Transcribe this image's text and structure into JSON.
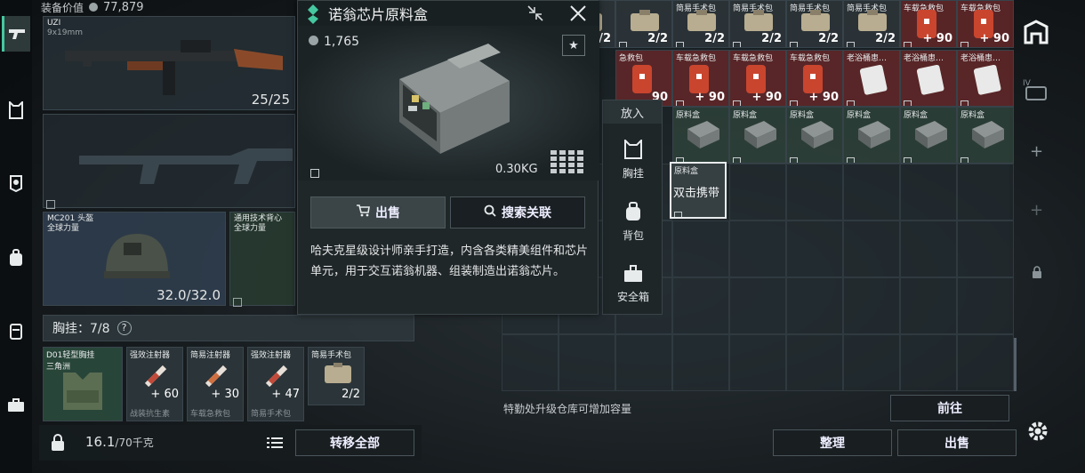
{
  "equipment": {
    "header_label": "装备价值",
    "value": "77,879",
    "weapon": {
      "name": "UZI",
      "caliber": "9x19mm",
      "ammo": "25/25"
    },
    "helmet": {
      "name": "MC201 头盔",
      "faction": "全球力量",
      "durability": "32.0/32.0"
    },
    "vest": {
      "name": "通用技术背心",
      "faction": "全球力量"
    }
  },
  "rig": {
    "label": "胸挂：7/8",
    "help": "?",
    "rig_item": {
      "name": "D01轻型胸挂",
      "sub": "三角洲"
    },
    "items": [
      {
        "name": "强效注射器",
        "count": "+ 60",
        "sub": "战装抗生素"
      },
      {
        "name": "简易注射器",
        "count": "+ 30",
        "sub": "车载急救包"
      },
      {
        "name": "强效注射器",
        "count": "+ 47",
        "sub": "简易手术包"
      },
      {
        "name": "简易手术包",
        "count": "2/2",
        "sub": ""
      }
    ]
  },
  "bottom_bar": {
    "weight": "16.1",
    "weight_max": "/70千克",
    "transfer_all": "转移全部"
  },
  "popup": {
    "title": "诺翁芯片原料盒",
    "price": "1,765",
    "weight": "0.30KG",
    "sell_label": "出售",
    "search_label": "搜索关联",
    "description": "哈夫克星级设计师亲手打造，内含各类精美组件和芯片单元，用于交互诺翁机器、组装制造出诺翁芯片。"
  },
  "put_in": {
    "title": "放入",
    "options": [
      "胸挂",
      "背包",
      "安全箱"
    ]
  },
  "stash": {
    "row0": [
      {
        "label": "",
        "count": "/2",
        "type": "plain"
      },
      {
        "label": "",
        "count": "2/2",
        "type": "plain"
      },
      {
        "label": "简易手术包",
        "count": "2/2",
        "type": "plain"
      },
      {
        "label": "简易手术包",
        "count": "2/2",
        "type": "plain"
      },
      {
        "label": "简易手术包",
        "count": "2/2",
        "type": "plain"
      },
      {
        "label": "简易手术包",
        "count": "2/2",
        "type": "plain"
      },
      {
        "label": "车载急救包",
        "count": "+ 90",
        "type": "red"
      },
      {
        "label": "车载急救包",
        "count": "+ 90",
        "type": "red"
      }
    ],
    "row1": [
      {
        "label": "急救包",
        "count": "90",
        "type": "red"
      },
      {
        "label": "车载急救包",
        "count": "+ 90",
        "type": "red"
      },
      {
        "label": "车载急救包",
        "count": "+ 90",
        "type": "red"
      },
      {
        "label": "车载急救包",
        "count": "+ 90",
        "type": "red"
      },
      {
        "label": "老浴桶患…",
        "count": "",
        "type": "red"
      },
      {
        "label": "老浴桶患…",
        "count": "",
        "type": "red"
      },
      {
        "label": "老浴桶患…",
        "count": "",
        "type": "red"
      }
    ],
    "row2": [
      {
        "label": "原料盒",
        "type": "green"
      },
      {
        "label": "原料盒",
        "type": "green"
      },
      {
        "label": "原料盒",
        "type": "green"
      },
      {
        "label": "原料盒",
        "type": "green"
      },
      {
        "label": "原料盒",
        "type": "green"
      },
      {
        "label": "原料盒",
        "type": "green"
      }
    ],
    "held_item": {
      "label": "原料盒",
      "hint": "双击携带"
    },
    "upgrade_hint": "特勤处升级仓库可增加容量",
    "goto_label": "前往",
    "organize_label": "整理",
    "sell_label": "出售"
  },
  "colors": {
    "accent": "#46c7a0",
    "red_item": "#6e282a",
    "green_item": "#30463c"
  }
}
